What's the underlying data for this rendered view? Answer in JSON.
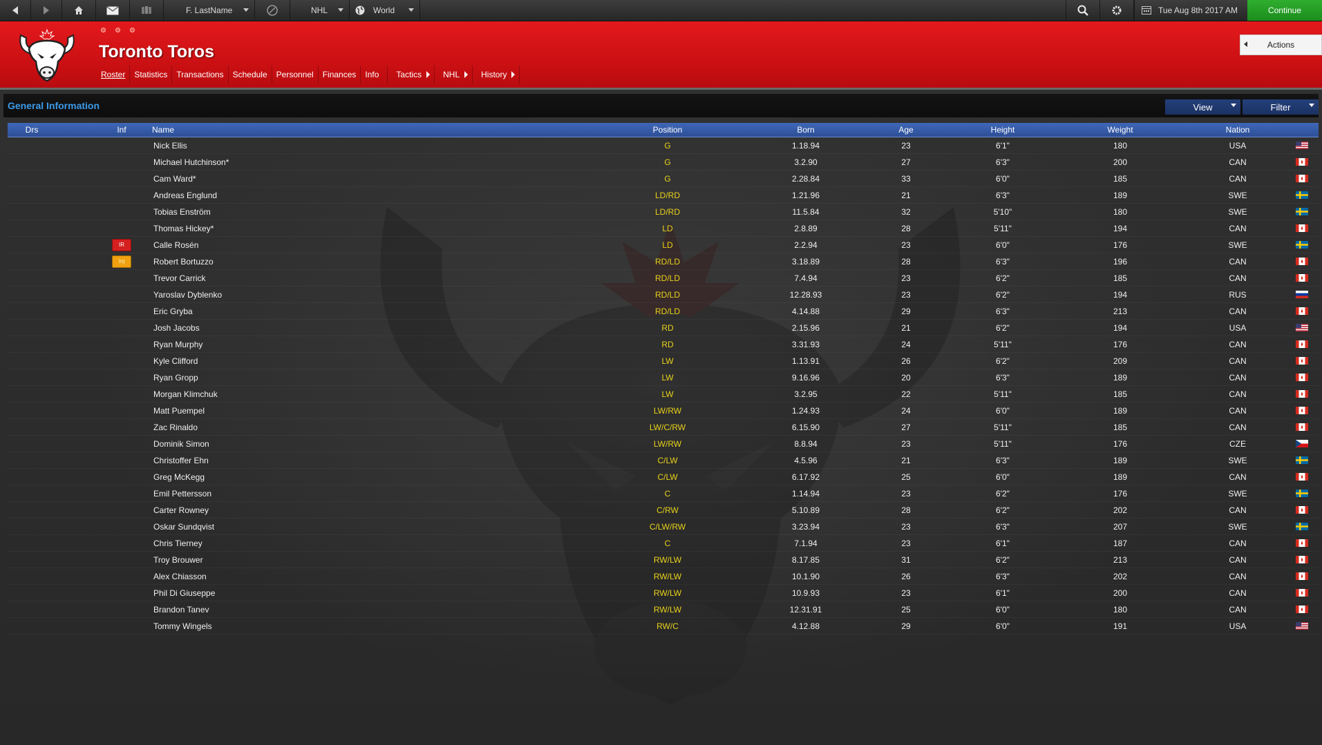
{
  "topbar": {
    "profile_label": "F. LastName",
    "league_label": "NHL",
    "region_label": "World",
    "date": "Tue Aug 8th 2017 AM",
    "continue_label": "Continue"
  },
  "header": {
    "team_name": "Toronto Toros",
    "actions_label": "Actions",
    "nav": [
      {
        "label": "Roster"
      },
      {
        "label": "Statistics"
      },
      {
        "label": "Transactions"
      },
      {
        "label": "Schedule"
      },
      {
        "label": "Personnel"
      },
      {
        "label": "Finances"
      },
      {
        "label": "Info"
      },
      {
        "label": "Tactics"
      },
      {
        "label": "NHL"
      },
      {
        "label": "History"
      }
    ],
    "brand_color": "#d71518"
  },
  "section": {
    "title": "General Information",
    "view_label": "View",
    "filter_label": "Filter"
  },
  "table": {
    "headers": {
      "drs": "Drs",
      "inf": "Inf",
      "name": "Name",
      "position": "Position",
      "born": "Born",
      "age": "Age",
      "height": "Height",
      "weight": "Weight",
      "nation": "Nation"
    },
    "rows": [
      {
        "inf": "",
        "name": "Nick Ellis",
        "pos": "G",
        "born": "1.18.94",
        "age": "23",
        "height": "6'1\"",
        "weight": "180",
        "nation": "USA"
      },
      {
        "inf": "",
        "name": "Michael Hutchinson*",
        "pos": "G",
        "born": "3.2.90",
        "age": "27",
        "height": "6'3\"",
        "weight": "200",
        "nation": "CAN"
      },
      {
        "inf": "",
        "name": "Cam Ward*",
        "pos": "G",
        "born": "2.28.84",
        "age": "33",
        "height": "6'0\"",
        "weight": "185",
        "nation": "CAN"
      },
      {
        "inf": "",
        "name": "Andreas Englund",
        "pos": "LD/RD",
        "born": "1.21.96",
        "age": "21",
        "height": "6'3\"",
        "weight": "189",
        "nation": "SWE"
      },
      {
        "inf": "",
        "name": "Tobias Enström",
        "pos": "LD/RD",
        "born": "11.5.84",
        "age": "32",
        "height": "5'10\"",
        "weight": "180",
        "nation": "SWE"
      },
      {
        "inf": "",
        "name": "Thomas Hickey*",
        "pos": "LD",
        "born": "2.8.89",
        "age": "28",
        "height": "5'11\"",
        "weight": "194",
        "nation": "CAN"
      },
      {
        "inf": "IR",
        "name": "Calle Rosén",
        "pos": "LD",
        "born": "2.2.94",
        "age": "23",
        "height": "6'0\"",
        "weight": "176",
        "nation": "SWE"
      },
      {
        "inf": "Inj",
        "name": "Robert Bortuzzo",
        "pos": "RD/LD",
        "born": "3.18.89",
        "age": "28",
        "height": "6'3\"",
        "weight": "196",
        "nation": "CAN"
      },
      {
        "inf": "",
        "name": "Trevor Carrick",
        "pos": "RD/LD",
        "born": "7.4.94",
        "age": "23",
        "height": "6'2\"",
        "weight": "185",
        "nation": "CAN"
      },
      {
        "inf": "",
        "name": "Yaroslav Dyblenko",
        "pos": "RD/LD",
        "born": "12.28.93",
        "age": "23",
        "height": "6'2\"",
        "weight": "194",
        "nation": "RUS"
      },
      {
        "inf": "",
        "name": "Eric Gryba",
        "pos": "RD/LD",
        "born": "4.14.88",
        "age": "29",
        "height": "6'3\"",
        "weight": "213",
        "nation": "CAN"
      },
      {
        "inf": "",
        "name": "Josh Jacobs",
        "pos": "RD",
        "born": "2.15.96",
        "age": "21",
        "height": "6'2\"",
        "weight": "194",
        "nation": "USA"
      },
      {
        "inf": "",
        "name": "Ryan Murphy",
        "pos": "RD",
        "born": "3.31.93",
        "age": "24",
        "height": "5'11\"",
        "weight": "176",
        "nation": "CAN"
      },
      {
        "inf": "",
        "name": "Kyle Clifford",
        "pos": "LW",
        "born": "1.13.91",
        "age": "26",
        "height": "6'2\"",
        "weight": "209",
        "nation": "CAN"
      },
      {
        "inf": "",
        "name": "Ryan Gropp",
        "pos": "LW",
        "born": "9.16.96",
        "age": "20",
        "height": "6'3\"",
        "weight": "189",
        "nation": "CAN"
      },
      {
        "inf": "",
        "name": "Morgan Klimchuk",
        "pos": "LW",
        "born": "3.2.95",
        "age": "22",
        "height": "5'11\"",
        "weight": "185",
        "nation": "CAN"
      },
      {
        "inf": "",
        "name": "Matt Puempel",
        "pos": "LW/RW",
        "born": "1.24.93",
        "age": "24",
        "height": "6'0\"",
        "weight": "189",
        "nation": "CAN"
      },
      {
        "inf": "",
        "name": "Zac Rinaldo",
        "pos": "LW/C/RW",
        "born": "6.15.90",
        "age": "27",
        "height": "5'11\"",
        "weight": "185",
        "nation": "CAN"
      },
      {
        "inf": "",
        "name": "Dominik Simon",
        "pos": "LW/RW",
        "born": "8.8.94",
        "age": "23",
        "height": "5'11\"",
        "weight": "176",
        "nation": "CZE"
      },
      {
        "inf": "",
        "name": "Christoffer Ehn",
        "pos": "C/LW",
        "born": "4.5.96",
        "age": "21",
        "height": "6'3\"",
        "weight": "189",
        "nation": "SWE"
      },
      {
        "inf": "",
        "name": "Greg McKegg",
        "pos": "C/LW",
        "born": "6.17.92",
        "age": "25",
        "height": "6'0\"",
        "weight": "189",
        "nation": "CAN"
      },
      {
        "inf": "",
        "name": "Emil Pettersson",
        "pos": "C",
        "born": "1.14.94",
        "age": "23",
        "height": "6'2\"",
        "weight": "176",
        "nation": "SWE"
      },
      {
        "inf": "",
        "name": "Carter Rowney",
        "pos": "C/RW",
        "born": "5.10.89",
        "age": "28",
        "height": "6'2\"",
        "weight": "202",
        "nation": "CAN"
      },
      {
        "inf": "",
        "name": "Oskar Sundqvist",
        "pos": "C/LW/RW",
        "born": "3.23.94",
        "age": "23",
        "height": "6'3\"",
        "weight": "207",
        "nation": "SWE"
      },
      {
        "inf": "",
        "name": "Chris Tierney",
        "pos": "C",
        "born": "7.1.94",
        "age": "23",
        "height": "6'1\"",
        "weight": "187",
        "nation": "CAN"
      },
      {
        "inf": "",
        "name": "Troy Brouwer",
        "pos": "RW/LW",
        "born": "8.17.85",
        "age": "31",
        "height": "6'2\"",
        "weight": "213",
        "nation": "CAN"
      },
      {
        "inf": "",
        "name": "Alex Chiasson",
        "pos": "RW/LW",
        "born": "10.1.90",
        "age": "26",
        "height": "6'3\"",
        "weight": "202",
        "nation": "CAN"
      },
      {
        "inf": "",
        "name": "Phil Di Giuseppe",
        "pos": "RW/LW",
        "born": "10.9.93",
        "age": "23",
        "height": "6'1\"",
        "weight": "200",
        "nation": "CAN"
      },
      {
        "inf": "",
        "name": "Brandon Tanev",
        "pos": "RW/LW",
        "born": "12.31.91",
        "age": "25",
        "height": "6'0\"",
        "weight": "180",
        "nation": "CAN"
      },
      {
        "inf": "",
        "name": "Tommy Wingels",
        "pos": "RW/C",
        "born": "4.12.88",
        "age": "29",
        "height": "6'0\"",
        "weight": "191",
        "nation": "USA"
      }
    ]
  }
}
